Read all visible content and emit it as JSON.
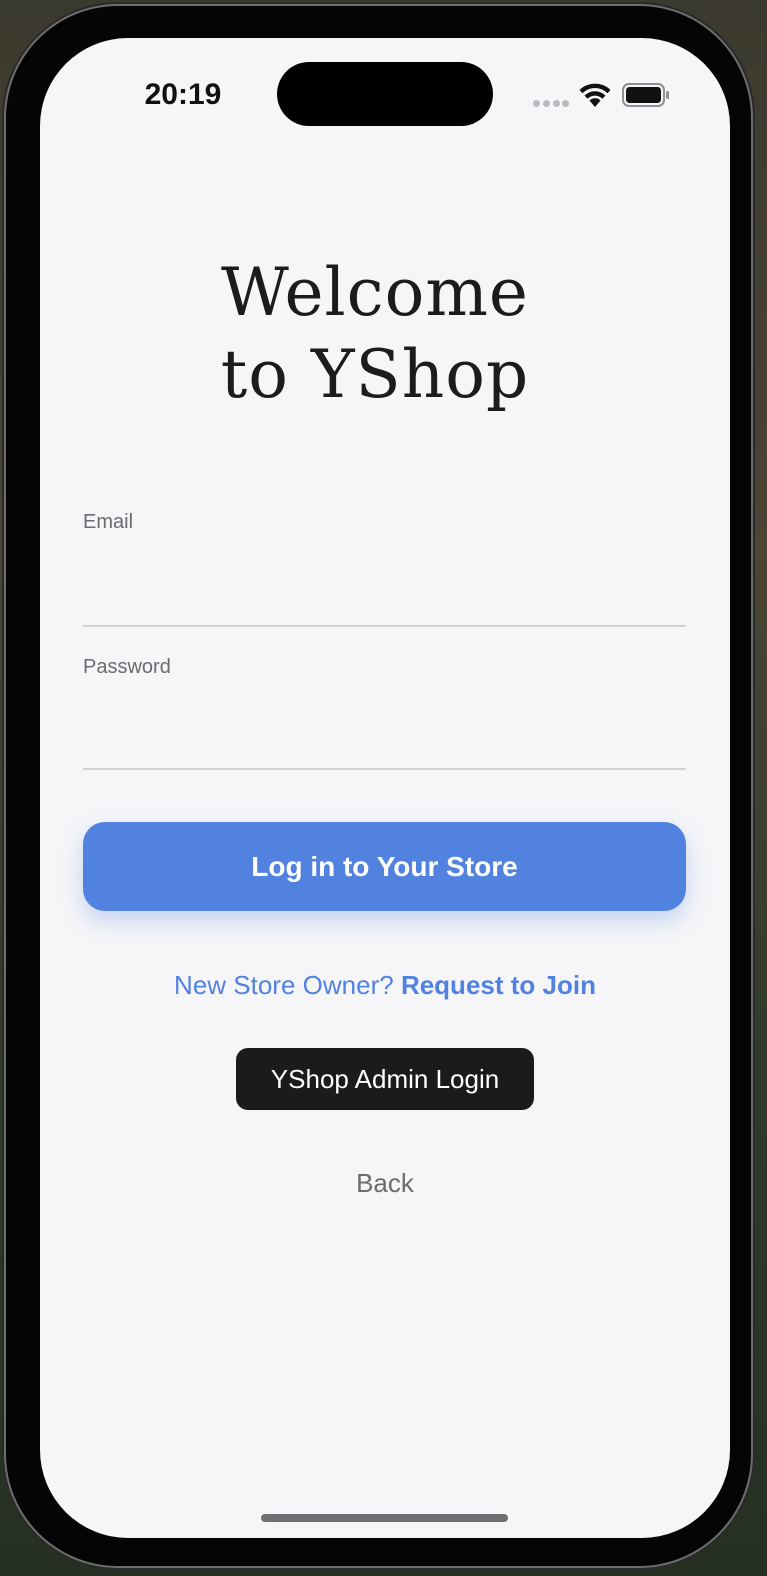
{
  "status_bar": {
    "time": "20:19",
    "icons": [
      "cellular-dots-icon",
      "wifi-icon",
      "battery-icon"
    ]
  },
  "header": {
    "title_line1": "Welcome",
    "title_line2": "to YShop"
  },
  "form": {
    "email_label": "Email",
    "email_value": "",
    "password_label": "Password",
    "password_value": ""
  },
  "actions": {
    "login_label": "Log in to Your Store",
    "new_owner_prefix": "New Store Owner?",
    "request_join_label": "Request to Join",
    "admin_login_label": "YShop Admin Login",
    "back_label": "Back"
  },
  "colors": {
    "accent": "#5282e0",
    "background": "#f6f6f9",
    "dark_button": "#1b1b1b",
    "muted_text": "#6b6b70"
  }
}
